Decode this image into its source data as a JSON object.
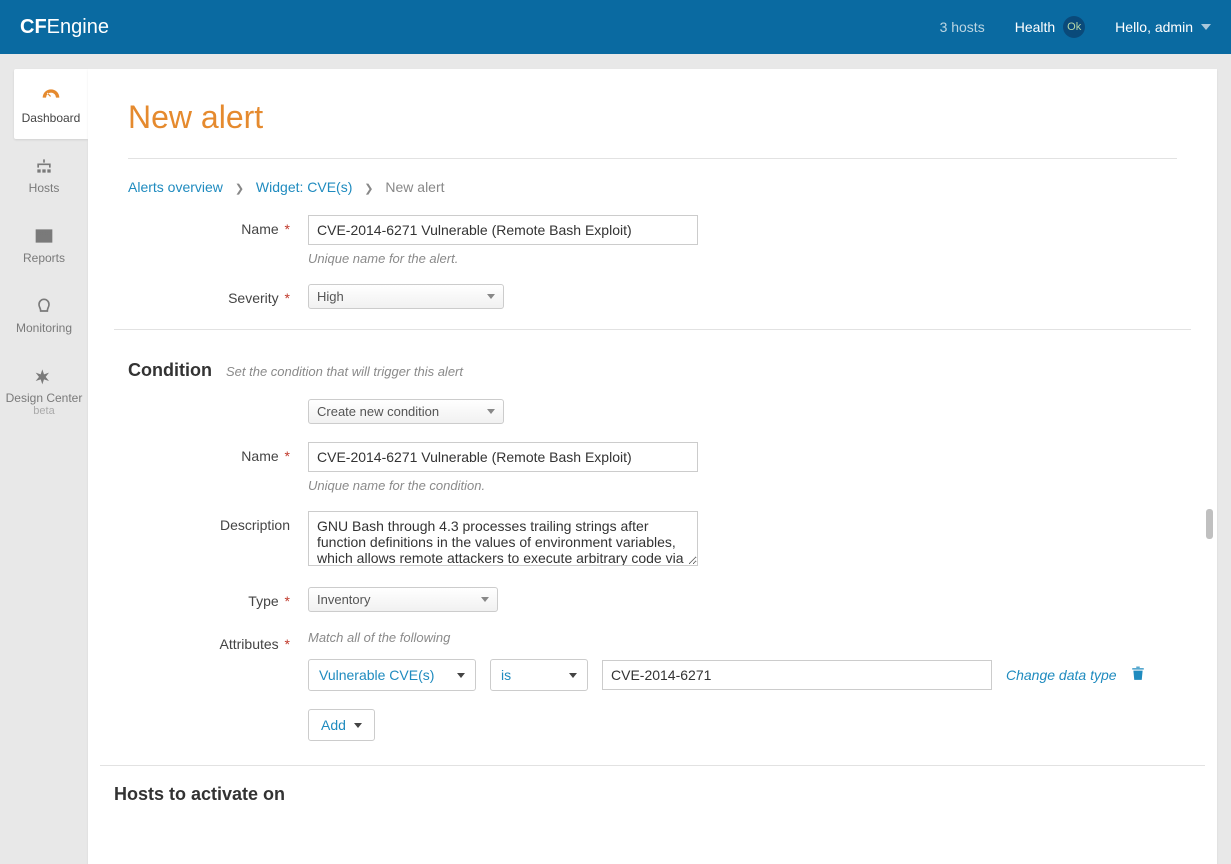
{
  "topbar": {
    "logo_bold": "CF",
    "logo_light": "Engine",
    "hosts": "3 hosts",
    "health_label": "Health",
    "ok": "Ok",
    "user": "Hello, admin"
  },
  "sidebar": {
    "items": [
      {
        "label": "Dashboard"
      },
      {
        "label": "Hosts"
      },
      {
        "label": "Reports"
      },
      {
        "label": "Monitoring"
      },
      {
        "label": "Design Center",
        "sub": "beta"
      }
    ]
  },
  "page": {
    "title": "New alert"
  },
  "breadcrumbs": {
    "a": "Alerts overview",
    "b": "Widget: CVE(s)",
    "c": "New alert"
  },
  "alert": {
    "name_label": "Name",
    "name_value": "CVE-2014-6271 Vulnerable (Remote Bash Exploit)",
    "name_hint": "Unique name for the alert.",
    "severity_label": "Severity",
    "severity_value": "High"
  },
  "condition": {
    "title": "Condition",
    "subtitle": "Set the condition that will trigger this alert",
    "create_label": "Create new condition",
    "name_label": "Name",
    "name_value": "CVE-2014-6271 Vulnerable (Remote Bash Exploit)",
    "name_hint": "Unique name for the condition.",
    "desc_label": "Description",
    "desc_value": "GNU Bash through 4.3 processes trailing strings after function definitions in the values of environment variables, which allows remote attackers to execute arbitrary code via a",
    "type_label": "Type",
    "type_value": "Inventory",
    "attr_label": "Attributes",
    "attr_hint": "Match all of the following",
    "attr_field": "Vulnerable CVE(s)",
    "attr_op": "is",
    "attr_value": "CVE-2014-6271",
    "change_link": "Change data type",
    "add_label": "Add"
  },
  "hosts": {
    "title": "Hosts to activate on"
  }
}
